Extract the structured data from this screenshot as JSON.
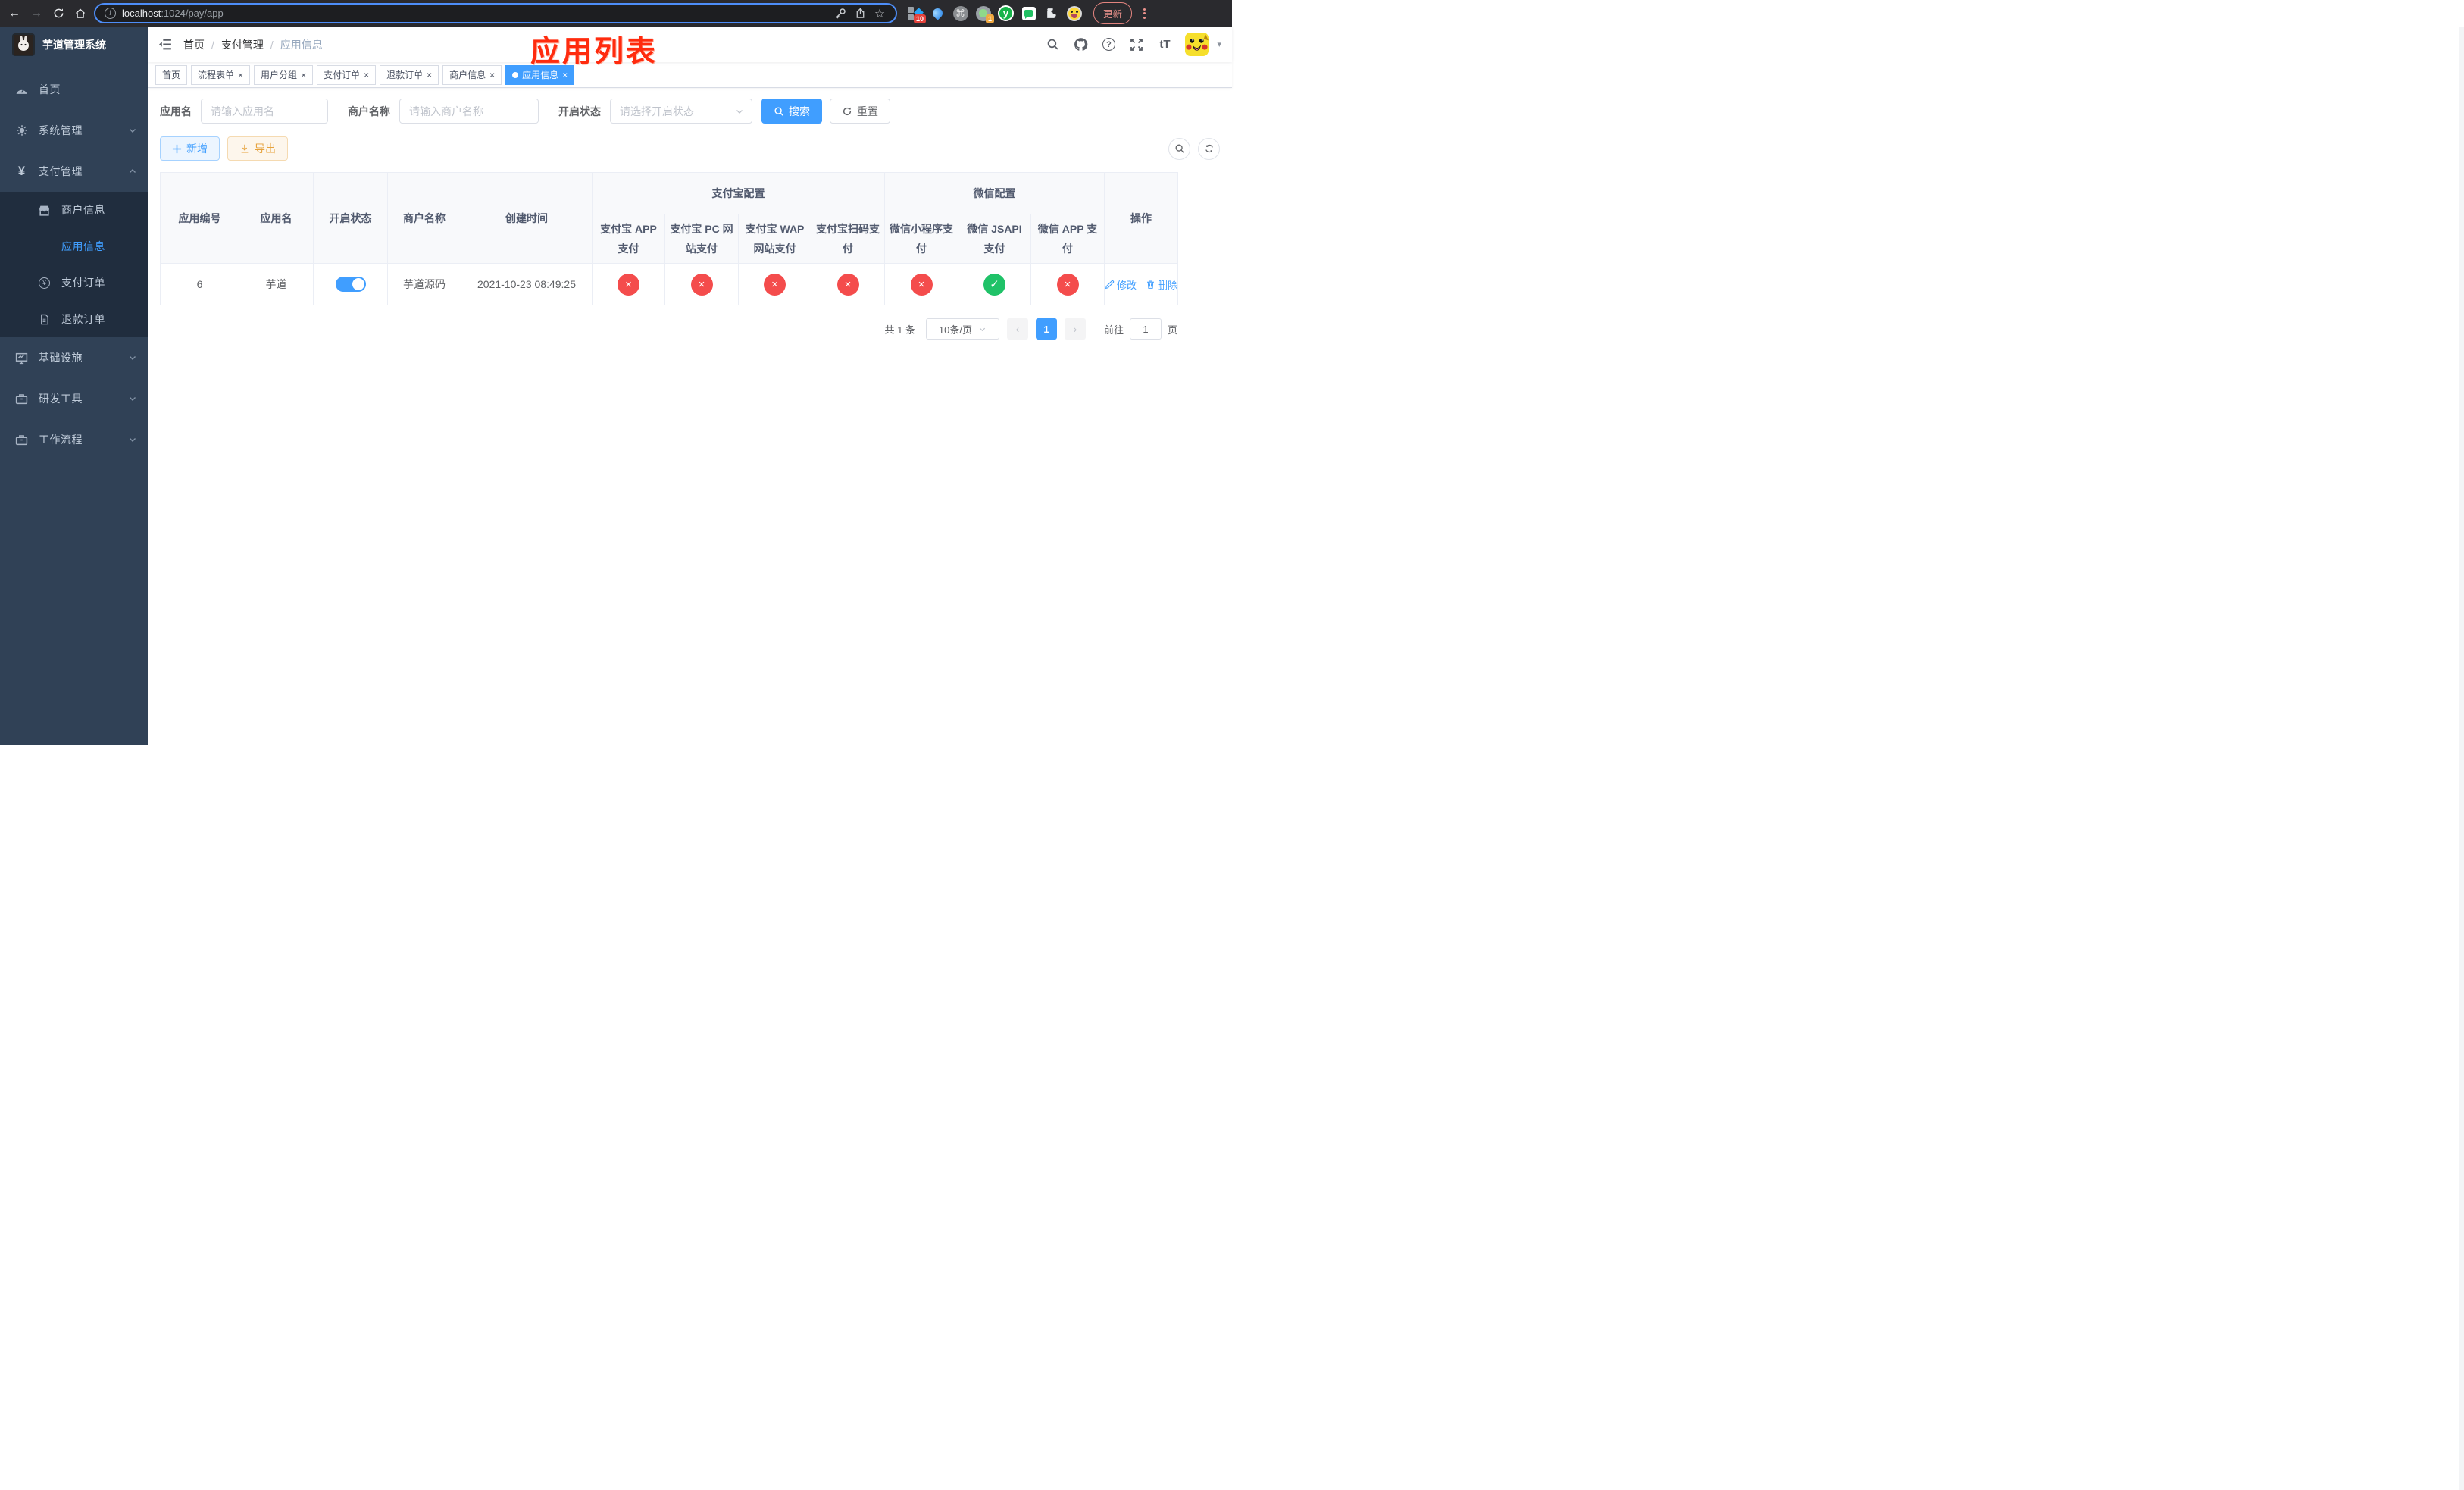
{
  "browser": {
    "url_host": "localhost",
    "url_rest": ":1024/pay/app",
    "update_label": "更新",
    "extension_badge_blocks": "10",
    "extension_badge_target": "1",
    "extension_y_label": "y"
  },
  "glyphs": {
    "back": "←",
    "forward": "→",
    "command": "⌘",
    "star": "☆",
    "info": "i",
    "help": "?",
    "font_size": "tT",
    "caret_down": "▾",
    "slash": "/",
    "cross": "×",
    "check": "✓",
    "prev": "‹",
    "next": "›",
    "yuan": "¥",
    "close": "×",
    "plus": "＋"
  },
  "annotation": {
    "title": "应用列表"
  },
  "sidebar": {
    "logo_title": "芋道管理系统",
    "items": [
      {
        "label": "首页"
      },
      {
        "label": "系统管理"
      },
      {
        "label": "支付管理"
      },
      {
        "label": "基础设施"
      },
      {
        "label": "研发工具"
      },
      {
        "label": "工作流程"
      }
    ],
    "subitems": [
      {
        "label": "商户信息"
      },
      {
        "label": "应用信息"
      },
      {
        "label": "支付订单"
      },
      {
        "label": "退款订单"
      }
    ]
  },
  "navbar": {
    "breadcrumb": [
      "首页",
      "支付管理",
      "应用信息"
    ]
  },
  "tabs": [
    {
      "label": "首页"
    },
    {
      "label": "流程表单"
    },
    {
      "label": "用户分组"
    },
    {
      "label": "支付订单"
    },
    {
      "label": "退款订单"
    },
    {
      "label": "商户信息"
    },
    {
      "label": "应用信息"
    }
  ],
  "filters": {
    "app_name_label": "应用名",
    "app_name_placeholder": "请输入应用名",
    "merchant_label": "商户名称",
    "merchant_placeholder": "请输入商户名称",
    "status_label": "开启状态",
    "status_placeholder": "请选择开启状态",
    "search_label": "搜索",
    "reset_label": "重置"
  },
  "toolbar": {
    "add_label": "新增",
    "export_label": "导出"
  },
  "table": {
    "columns": [
      "应用编号",
      "应用名",
      "开启状态",
      "商户名称",
      "创建时间"
    ],
    "group_alipay": "支付宝配置",
    "group_wechat": "微信配置",
    "alipay_columns": [
      "支付宝 APP 支付",
      "支付宝 PC 网站支付",
      "支付宝 WAP 网站支付",
      "支付宝扫码支付"
    ],
    "wechat_columns": [
      "微信小程序支付",
      "微信 JSAPI 支付",
      "微信 APP 支付"
    ],
    "ops_column": "操作",
    "row": {
      "id": "6",
      "name": "芋道",
      "enabled": true,
      "merchant": "芋道源码",
      "created": "2021-10-23 08:49:25",
      "config_statuses": [
        "closed",
        "closed",
        "closed",
        "closed",
        "closed",
        "open",
        "closed"
      ],
      "edit_label": "修改",
      "delete_label": "删除"
    }
  },
  "pagination": {
    "total_text": "共 1 条",
    "page_size": "10条/页",
    "current_page": "1",
    "goto_label": "前往",
    "goto_value": "1",
    "page_unit": "页"
  },
  "colors": {
    "primary": "#409eff",
    "danger": "#f44c4c",
    "success": "#1fc268",
    "warning": "#e6a23c",
    "sidebar_bg": "#304156",
    "submenu_bg": "#202d3e",
    "annotation_red": "#ff2b0e"
  }
}
